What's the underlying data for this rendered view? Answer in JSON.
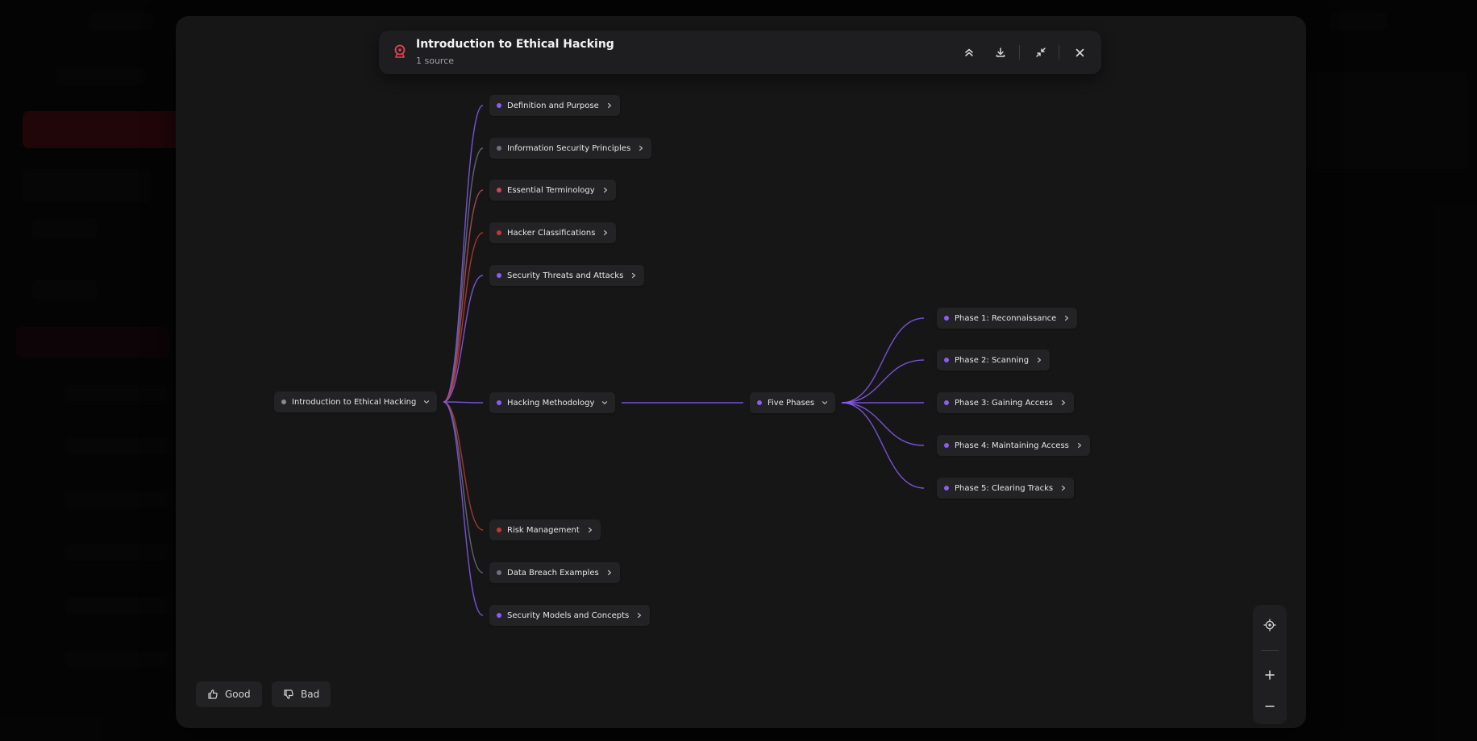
{
  "header": {
    "title": "Introduction to Ethical Hacking",
    "subtitle": "1 source"
  },
  "mindmap": {
    "root": {
      "label": "Introduction to Ethical Hacking"
    },
    "branches": [
      {
        "label": "Definition and Purpose",
        "color": "#8b5cf6"
      },
      {
        "label": "Information Security Principles",
        "color": "#6b7280"
      },
      {
        "label": "Essential Terminology",
        "color": "#c04a60"
      },
      {
        "label": "Hacker Classifications",
        "color": "#c0392b"
      },
      {
        "label": "Security Threats and Attacks",
        "color": "#8b5cf6"
      },
      {
        "label": "Hacking Methodology",
        "color": "#8b5cf6"
      },
      {
        "label": "Risk Management",
        "color": "#c0392b"
      },
      {
        "label": "Data Breach Examples",
        "color": "#6b7280"
      },
      {
        "label": "Security Models and Concepts",
        "color": "#8b5cf6"
      }
    ],
    "sub": {
      "label": "Five Phases"
    },
    "phases": [
      {
        "label": "Phase 1: Reconnaissance"
      },
      {
        "label": "Phase 2: Scanning"
      },
      {
        "label": "Phase 3: Gaining Access"
      },
      {
        "label": "Phase 4: Maintaining Access"
      },
      {
        "label": "Phase 5: Clearing Tracks"
      }
    ],
    "accent_color": "#8b5cf6",
    "root_dot_color": "#8a8a8f"
  },
  "feedback": {
    "good_label": "Good",
    "bad_label": "Bad"
  },
  "icons": {
    "logo": "mindmap-logo-icon",
    "collapse": "collapse-all-icon",
    "download": "download-icon",
    "minimize": "minimize-icon",
    "close": "close-icon",
    "recenter": "recenter-icon",
    "zoom_in": "plus-icon",
    "zoom_out": "minus-icon"
  }
}
